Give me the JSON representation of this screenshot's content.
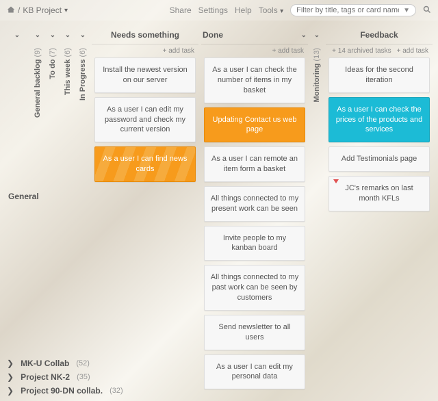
{
  "header": {
    "breadcrumb_sep": "/",
    "project_name": "KB Project",
    "links": {
      "share": "Share",
      "settings": "Settings",
      "help": "Help",
      "tools": "Tools"
    },
    "search_placeholder": "Filter by title, tags or card name"
  },
  "swimlane": {
    "label": "General"
  },
  "columns": {
    "collapsed": [
      {
        "name": "General backlog",
        "count": "(9)"
      },
      {
        "name": "To do",
        "count": "(7)"
      },
      {
        "name": "This week",
        "count": "(6)"
      },
      {
        "name": "In Progress",
        "count": "(6)"
      }
    ],
    "needs": {
      "title": "Needs something",
      "add": "+ add task",
      "cards": [
        {
          "text": "Install the newest version on our server",
          "style": ""
        },
        {
          "text": "As a user I can edit my password and check my current version",
          "style": ""
        },
        {
          "text": "As a user I can find news cards",
          "style": "orange-stripe"
        }
      ]
    },
    "done": {
      "title": "Done",
      "add": "+ add task",
      "cards": [
        {
          "text": "As a user I can check the number of items in my basket",
          "style": ""
        },
        {
          "text": "Updating Contact us web page",
          "style": "orange"
        },
        {
          "text": "As a user I can remote an item form a basket",
          "style": ""
        },
        {
          "text": "All things connected to my present work can be seen",
          "style": ""
        },
        {
          "text": "Invite people to my kanban board",
          "style": ""
        },
        {
          "text": "All things connected to my past work can be seen by customers",
          "style": ""
        },
        {
          "text": "Send newsletter to all users",
          "style": ""
        },
        {
          "text": "As a user I can edit my personal data",
          "style": ""
        }
      ]
    },
    "monitoring": {
      "name": "Monitoring",
      "count": "(13)"
    },
    "feedback": {
      "title": "Feedback",
      "archived": "+ 14 archived tasks",
      "add": "+ add task",
      "cards": [
        {
          "text": "Ideas for the second iteration",
          "style": ""
        },
        {
          "text": "As a user I can check the prices of the products and services",
          "style": "teal"
        },
        {
          "text": "Add Testimonials page",
          "style": ""
        },
        {
          "text": "JC's remarks on last month KFLs",
          "style": "",
          "flag": true
        }
      ]
    }
  },
  "projects": [
    {
      "name": "MK-U Collab",
      "count": "(52)"
    },
    {
      "name": "Project NK-2",
      "count": "(35)"
    },
    {
      "name": "Project 90-DN collab.",
      "count": "(32)"
    }
  ]
}
